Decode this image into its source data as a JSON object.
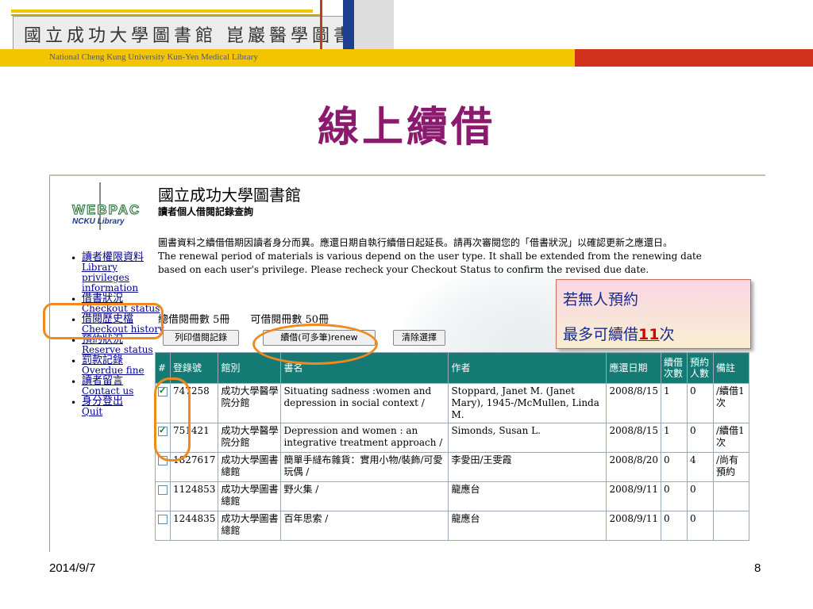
{
  "header": {
    "chinese_title": "國立成功大學圖書館 崑巖醫學圖書分館",
    "english_subtitle": "National Cheng Kung University Kun-Yen Medical Library"
  },
  "slide_title": "線上續借",
  "webpage": {
    "logo_text": "WEBPAC",
    "logo_sub": "NCKU Library",
    "site_title": "國立成功大學圖書館",
    "site_subtitle": "讀者個人借閱記錄查詢",
    "desc_zh": "圖書資料之續借借期因讀者身分而異。應還日期自執行續借日起延長。請再次審閱您的「借書狀況」以確認更新之應還日。",
    "desc_en": "The renewal period of materials is various depend on the user type. It shall be extended from the renewing date based on each user's privilege. Please recheck your Checkout Status to confirm the revised due date.",
    "counts": "總借閱冊數 5冊　　可借閱冊數 50冊",
    "buttons": {
      "print": "列印借閱記錄",
      "renew": "續借(可多筆)renew",
      "clear": "清除選擇"
    },
    "nav": [
      {
        "zh": "讀者權限資料",
        "en": "Library privileges information"
      },
      {
        "zh": "借書狀況",
        "en": "Checkout status"
      },
      {
        "zh": "借閱歷史檔",
        "en": "Checkout history"
      },
      {
        "zh": "預約狀況",
        "en": "Reserve status"
      },
      {
        "zh": "罰款記錄",
        "en": "Overdue fine"
      },
      {
        "zh": "讀者留言",
        "en": "Contact us"
      },
      {
        "zh": "身分登出",
        "en": "Quit"
      }
    ],
    "table": {
      "headers": [
        "#",
        "登錄號",
        "館別",
        "書名",
        "作者",
        "應還日期",
        "續借次數",
        "預約人數",
        "備註"
      ],
      "rows": [
        {
          "checked": true,
          "id": "747258",
          "branch": "成功大學醫學院分館",
          "title": "Situating sadness :women and depression in social context /",
          "author": "Stoppard, Janet M. (Janet Mary), 1945-/McMullen, Linda M.",
          "due": "2008/8/15",
          "renewals": "1",
          "holds": "0",
          "note": "/續借1次"
        },
        {
          "checked": true,
          "id": "751421",
          "branch": "成功大學醫學院分館",
          "title": "Depression and women : an integrative treatment approach /",
          "author": "Simonds, Susan L.",
          "due": "2008/8/15",
          "renewals": "1",
          "holds": "0",
          "note": "/續借1次"
        },
        {
          "checked": false,
          "id": "1827617",
          "branch": "成功大學圖書總館",
          "title": "簡單手縫布雜貨：實用小物/裝飾/可愛玩偶 /",
          "author": "李愛田/王雯霞",
          "due": "2008/8/20",
          "renewals": "0",
          "holds": "4",
          "note": "/尚有預約"
        },
        {
          "checked": false,
          "id": "1124853",
          "branch": "成功大學圖書總館",
          "title": "野火集 /",
          "author": "龍應台",
          "due": "2008/9/11",
          "renewals": "0",
          "holds": "0",
          "note": ""
        },
        {
          "checked": false,
          "id": "1244835",
          "branch": "成功大學圖書總館",
          "title": "百年思索 /",
          "author": "龍應台",
          "due": "2008/9/11",
          "renewals": "0",
          "holds": "0",
          "note": ""
        }
      ]
    }
  },
  "callout": {
    "line1": "若無人預約",
    "line2_prefix": "最多可續借",
    "line2_num": "11",
    "line2_suffix": "次"
  },
  "footer": {
    "date": "2014/9/7",
    "page": "8"
  }
}
